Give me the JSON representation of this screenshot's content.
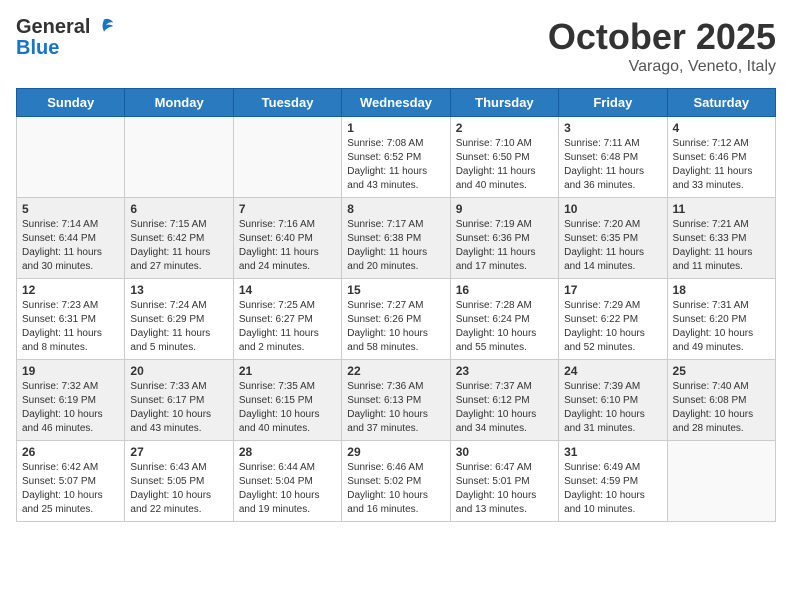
{
  "header": {
    "logo_general": "General",
    "logo_blue": "Blue",
    "month": "October 2025",
    "location": "Varago, Veneto, Italy"
  },
  "days_of_week": [
    "Sunday",
    "Monday",
    "Tuesday",
    "Wednesday",
    "Thursday",
    "Friday",
    "Saturday"
  ],
  "weeks": [
    [
      {
        "day": "",
        "info": ""
      },
      {
        "day": "",
        "info": ""
      },
      {
        "day": "",
        "info": ""
      },
      {
        "day": "1",
        "info": "Sunrise: 7:08 AM\nSunset: 6:52 PM\nDaylight: 11 hours and 43 minutes."
      },
      {
        "day": "2",
        "info": "Sunrise: 7:10 AM\nSunset: 6:50 PM\nDaylight: 11 hours and 40 minutes."
      },
      {
        "day": "3",
        "info": "Sunrise: 7:11 AM\nSunset: 6:48 PM\nDaylight: 11 hours and 36 minutes."
      },
      {
        "day": "4",
        "info": "Sunrise: 7:12 AM\nSunset: 6:46 PM\nDaylight: 11 hours and 33 minutes."
      }
    ],
    [
      {
        "day": "5",
        "info": "Sunrise: 7:14 AM\nSunset: 6:44 PM\nDaylight: 11 hours and 30 minutes."
      },
      {
        "day": "6",
        "info": "Sunrise: 7:15 AM\nSunset: 6:42 PM\nDaylight: 11 hours and 27 minutes."
      },
      {
        "day": "7",
        "info": "Sunrise: 7:16 AM\nSunset: 6:40 PM\nDaylight: 11 hours and 24 minutes."
      },
      {
        "day": "8",
        "info": "Sunrise: 7:17 AM\nSunset: 6:38 PM\nDaylight: 11 hours and 20 minutes."
      },
      {
        "day": "9",
        "info": "Sunrise: 7:19 AM\nSunset: 6:36 PM\nDaylight: 11 hours and 17 minutes."
      },
      {
        "day": "10",
        "info": "Sunrise: 7:20 AM\nSunset: 6:35 PM\nDaylight: 11 hours and 14 minutes."
      },
      {
        "day": "11",
        "info": "Sunrise: 7:21 AM\nSunset: 6:33 PM\nDaylight: 11 hours and 11 minutes."
      }
    ],
    [
      {
        "day": "12",
        "info": "Sunrise: 7:23 AM\nSunset: 6:31 PM\nDaylight: 11 hours and 8 minutes."
      },
      {
        "day": "13",
        "info": "Sunrise: 7:24 AM\nSunset: 6:29 PM\nDaylight: 11 hours and 5 minutes."
      },
      {
        "day": "14",
        "info": "Sunrise: 7:25 AM\nSunset: 6:27 PM\nDaylight: 11 hours and 2 minutes."
      },
      {
        "day": "15",
        "info": "Sunrise: 7:27 AM\nSunset: 6:26 PM\nDaylight: 10 hours and 58 minutes."
      },
      {
        "day": "16",
        "info": "Sunrise: 7:28 AM\nSunset: 6:24 PM\nDaylight: 10 hours and 55 minutes."
      },
      {
        "day": "17",
        "info": "Sunrise: 7:29 AM\nSunset: 6:22 PM\nDaylight: 10 hours and 52 minutes."
      },
      {
        "day": "18",
        "info": "Sunrise: 7:31 AM\nSunset: 6:20 PM\nDaylight: 10 hours and 49 minutes."
      }
    ],
    [
      {
        "day": "19",
        "info": "Sunrise: 7:32 AM\nSunset: 6:19 PM\nDaylight: 10 hours and 46 minutes."
      },
      {
        "day": "20",
        "info": "Sunrise: 7:33 AM\nSunset: 6:17 PM\nDaylight: 10 hours and 43 minutes."
      },
      {
        "day": "21",
        "info": "Sunrise: 7:35 AM\nSunset: 6:15 PM\nDaylight: 10 hours and 40 minutes."
      },
      {
        "day": "22",
        "info": "Sunrise: 7:36 AM\nSunset: 6:13 PM\nDaylight: 10 hours and 37 minutes."
      },
      {
        "day": "23",
        "info": "Sunrise: 7:37 AM\nSunset: 6:12 PM\nDaylight: 10 hours and 34 minutes."
      },
      {
        "day": "24",
        "info": "Sunrise: 7:39 AM\nSunset: 6:10 PM\nDaylight: 10 hours and 31 minutes."
      },
      {
        "day": "25",
        "info": "Sunrise: 7:40 AM\nSunset: 6:08 PM\nDaylight: 10 hours and 28 minutes."
      }
    ],
    [
      {
        "day": "26",
        "info": "Sunrise: 6:42 AM\nSunset: 5:07 PM\nDaylight: 10 hours and 25 minutes."
      },
      {
        "day": "27",
        "info": "Sunrise: 6:43 AM\nSunset: 5:05 PM\nDaylight: 10 hours and 22 minutes."
      },
      {
        "day": "28",
        "info": "Sunrise: 6:44 AM\nSunset: 5:04 PM\nDaylight: 10 hours and 19 minutes."
      },
      {
        "day": "29",
        "info": "Sunrise: 6:46 AM\nSunset: 5:02 PM\nDaylight: 10 hours and 16 minutes."
      },
      {
        "day": "30",
        "info": "Sunrise: 6:47 AM\nSunset: 5:01 PM\nDaylight: 10 hours and 13 minutes."
      },
      {
        "day": "31",
        "info": "Sunrise: 6:49 AM\nSunset: 4:59 PM\nDaylight: 10 hours and 10 minutes."
      },
      {
        "day": "",
        "info": ""
      }
    ]
  ]
}
